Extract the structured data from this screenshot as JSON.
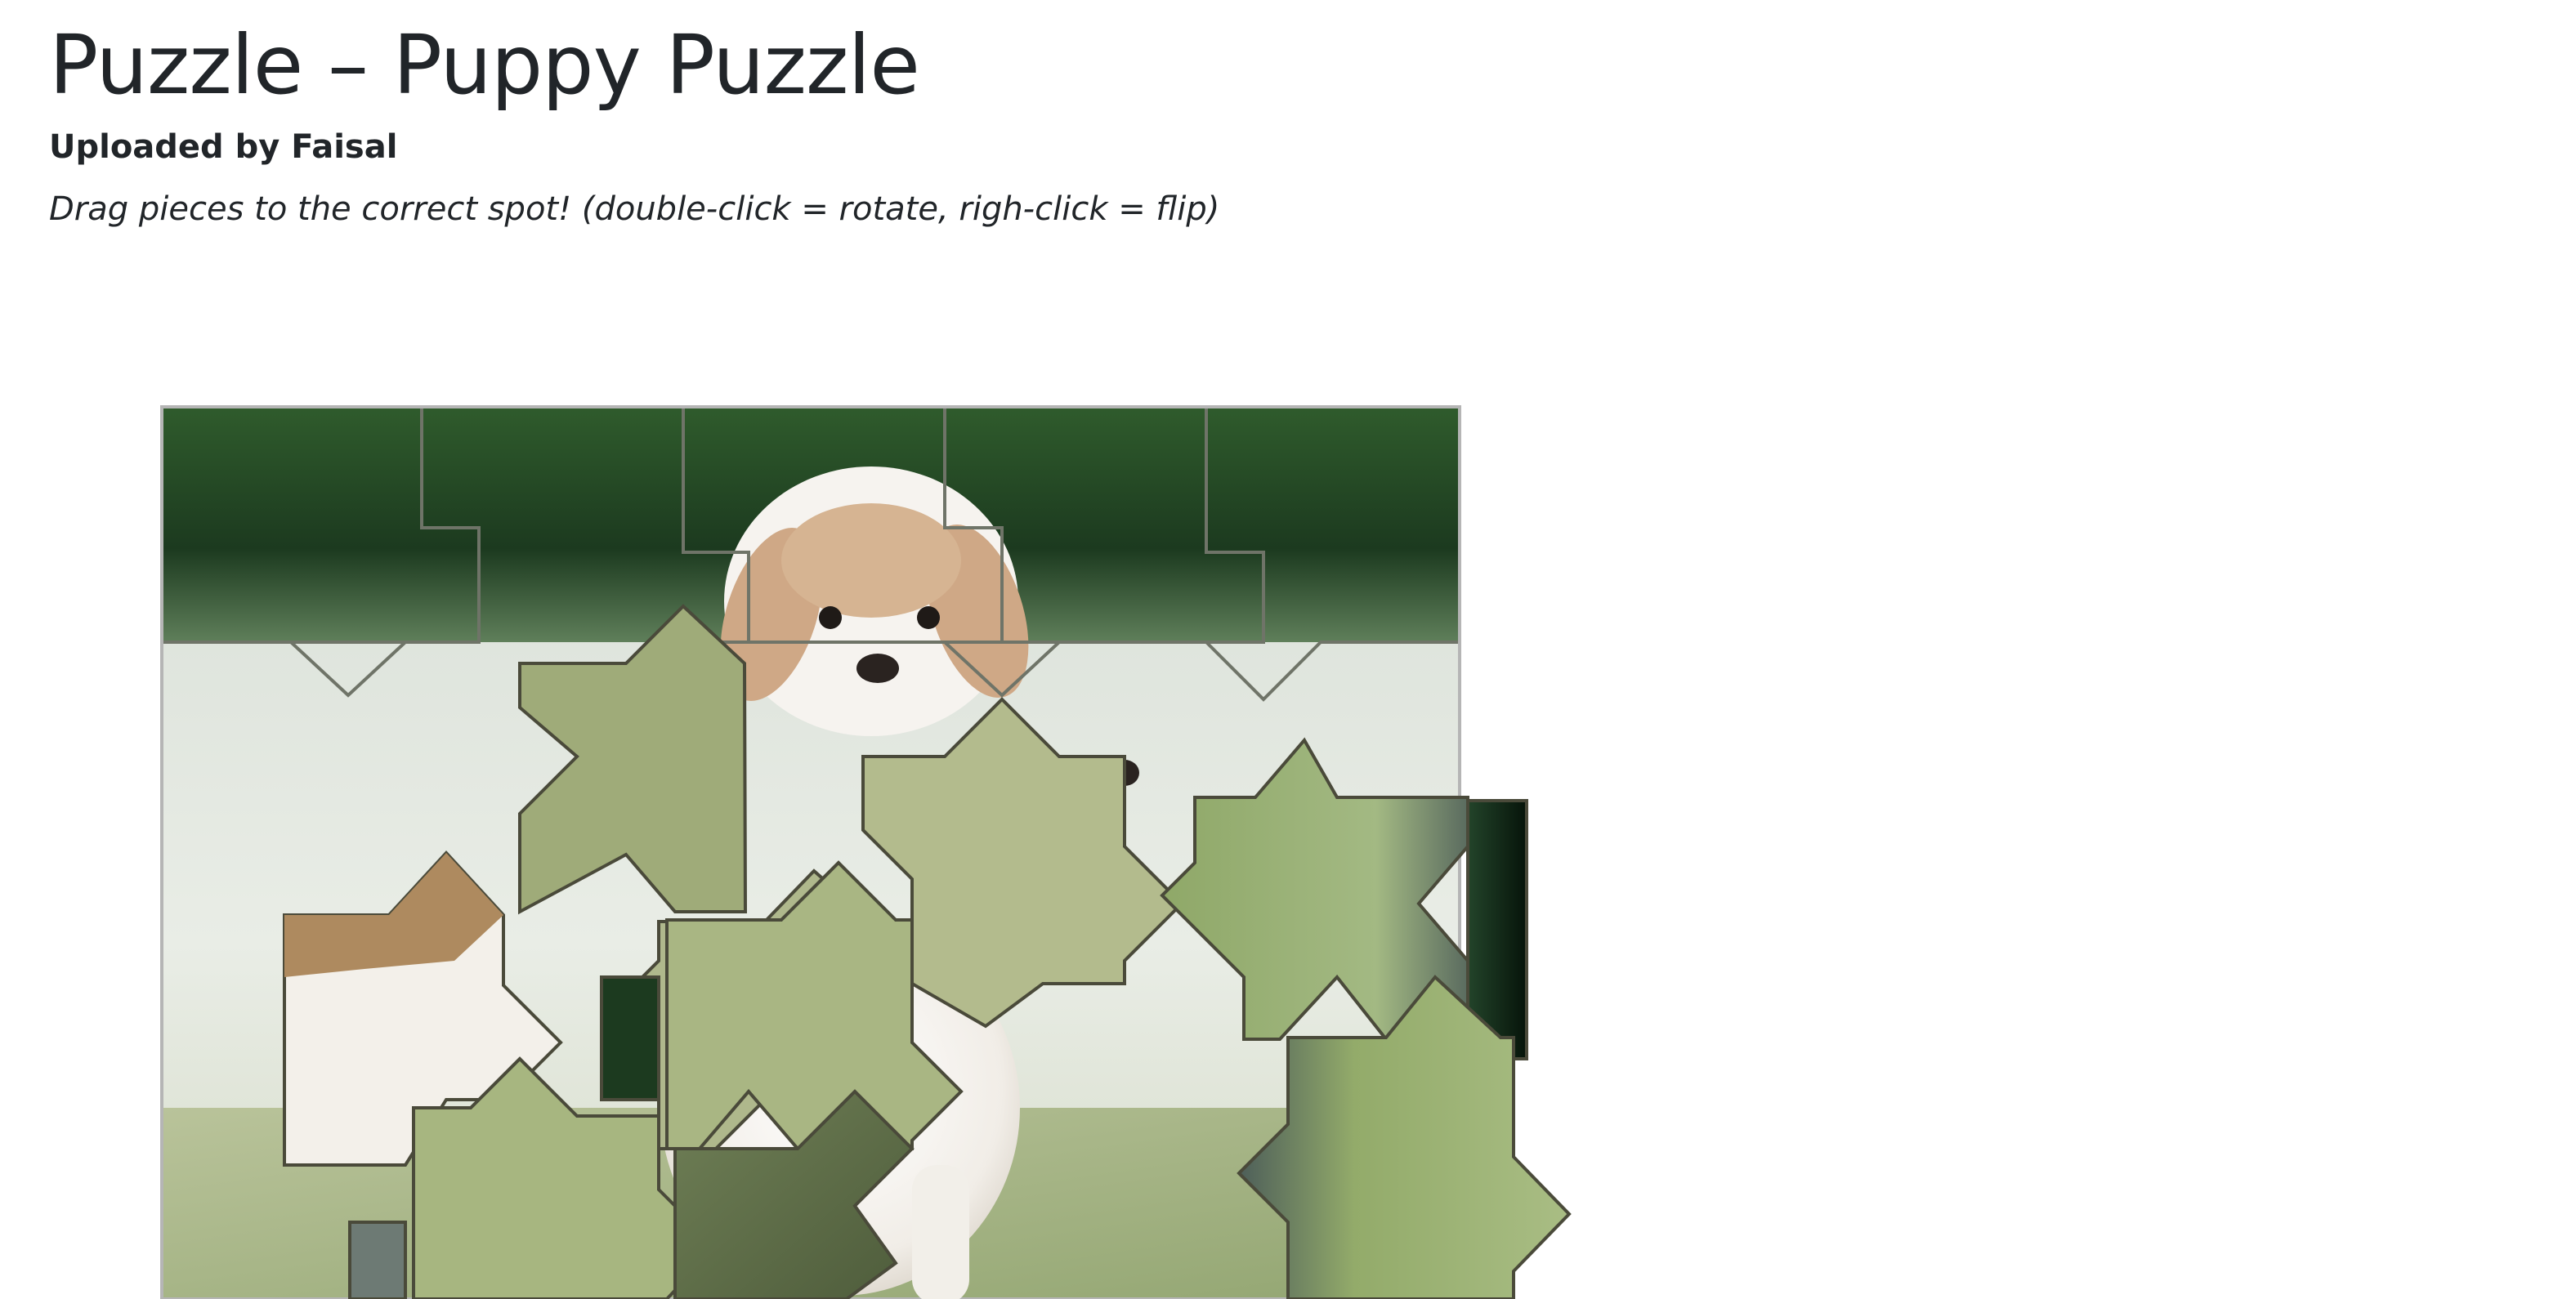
{
  "page": {
    "title": "Puzzle – Puppy Puzzle",
    "uploader": "Uploaded by Faisal",
    "instructions": "Drag pieces to the correct spot! (double-click = rotate, righ-click = flip)"
  },
  "puzzle": {
    "name": "Puppy Puzzle",
    "image_subject": "puppy standing on grass",
    "colors": {
      "dark_green": "#0f2416",
      "mid_green": "#2f5b2c",
      "light_field": "#dfe7de",
      "grass": "#a8b886",
      "puppy_white": "#f4f1ed",
      "puppy_tan": "#c9a37e",
      "piece_outline": "#4a4a3a"
    }
  }
}
